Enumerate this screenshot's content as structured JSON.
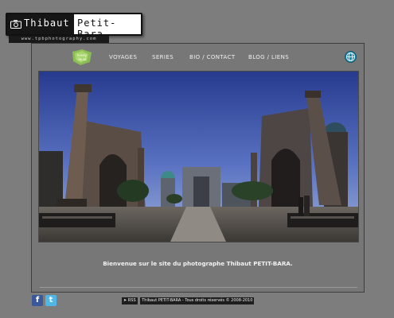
{
  "logo": {
    "first_name": "Thibaut",
    "last_name": "Petit-Bara",
    "url": "www.tpbphotography.com"
  },
  "nav": {
    "badge_label": "Lonely Liquid",
    "items": [
      {
        "label": "VOYAGES"
      },
      {
        "label": "SERIES"
      },
      {
        "label": "BIO / CONTACT"
      },
      {
        "label": "BLOG / LIENS"
      }
    ]
  },
  "main": {
    "welcome": "Bienvenue sur le site du photographe Thibaut PETIT-BARA."
  },
  "footer": {
    "rss": "RSS",
    "copyright": "Thibaut PETIT-BARA - Tous droits réservés © 2008-2010"
  },
  "colors": {
    "background": "#7d7d7d",
    "frame_border": "#3e3e3e",
    "facebook": "#3b5998",
    "twitter": "#4fb6e8"
  }
}
